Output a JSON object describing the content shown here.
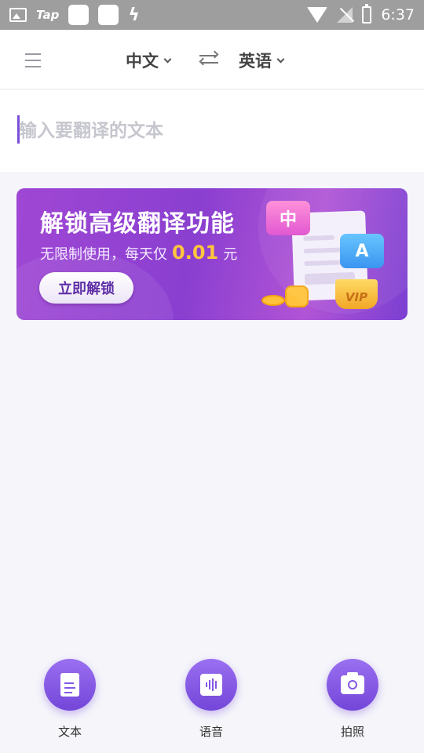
{
  "status_bar": {
    "app_label": "Tap",
    "time": "6:37"
  },
  "header": {
    "source_lang": "中文",
    "target_lang": "英语"
  },
  "input": {
    "placeholder": "输入要翻译的文本",
    "value": ""
  },
  "banner": {
    "title": "解锁高级翻译功能",
    "subtitle_prefix": "无限制使用，每天仅",
    "price": "0.01",
    "price_unit": "元",
    "button_label": "立即解锁",
    "illustration": {
      "zh_label": "中",
      "en_label": "A",
      "vip_label": "VIP"
    }
  },
  "bottom_bar": {
    "items": [
      {
        "label": "文本",
        "icon": "document-icon"
      },
      {
        "label": "语音",
        "icon": "voice-icon"
      },
      {
        "label": "拍照",
        "icon": "camera-icon"
      }
    ]
  },
  "colors": {
    "accent": "#7a4cd8",
    "banner_gradient_start": "#a047d4",
    "price": "#ffc53d"
  }
}
